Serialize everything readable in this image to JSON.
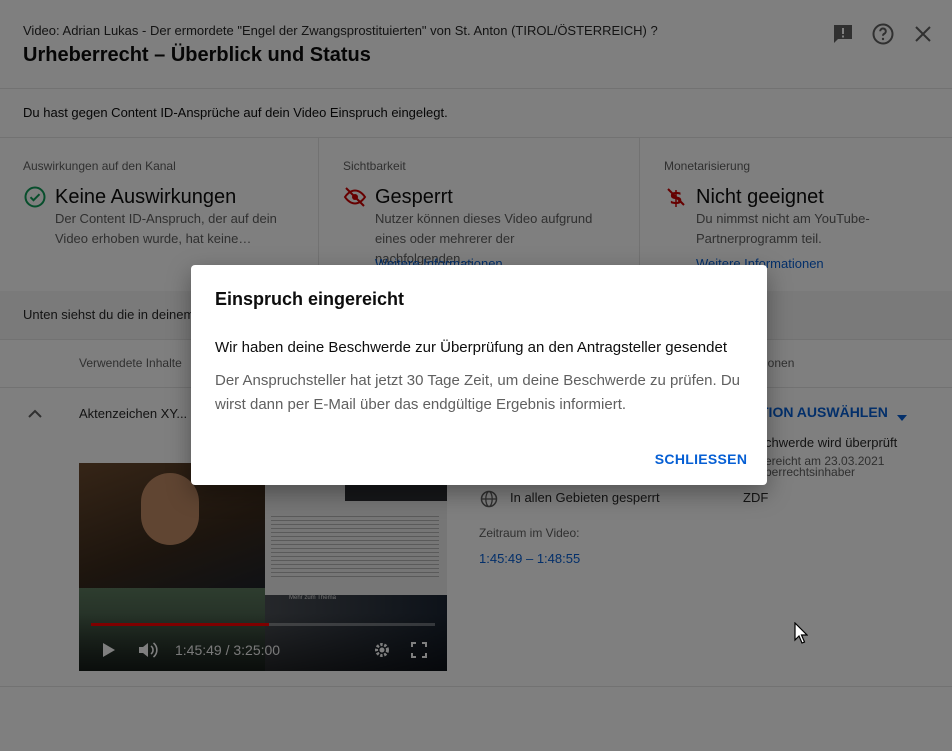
{
  "header": {
    "video_title": "Video: Adrian Lukas - Der ermordete \"Engel der Zwangsprostituierten\" von St. Anton (TIROL/ÖSTERREICH) ?",
    "page_title": "Urheberrecht – Überblick und Status",
    "icons": [
      "feedback-icon",
      "help-icon",
      "close-icon"
    ]
  },
  "notice": "Du hast gegen Content ID-Ansprüche auf dein Video Einspruch eingelegt.",
  "summary": [
    {
      "heading": "Auswirkungen auf den Kanal",
      "status": "Keine Auswirkungen",
      "description": "Der Content ID-Anspruch, der auf dein Video erhoben wurde, hat keine…",
      "link": "",
      "icon": "check-circle-icon",
      "color": "#0f9d58"
    },
    {
      "heading": "Sichtbarkeit",
      "status": "Gesperrt",
      "description": "Nutzer können dieses Video aufgrund eines oder mehrerer der nachfolgenden…",
      "link": "Weitere Informationen",
      "icon": "eye-off-icon",
      "color": "#cc0000"
    },
    {
      "heading": "Monetarisierung",
      "status": "Nicht geeignet",
      "description": "Du nimmst nicht am YouTube-Partnerprogramm teil.",
      "link": "Weitere Informationen",
      "icon": "no-money-icon",
      "color": "#cc0000"
    }
  ],
  "claims_intro": "Unten siehst du die in deinem",
  "table": {
    "col_content": "Verwendete Inhalte",
    "col_actions": "ionen",
    "row_title": "Aktenzeichen XY... u",
    "action_button": "TION AUSWÄHLEN",
    "claim_status": "chwerde wird überprüft",
    "claim_date": "ereicht am 23.03.2021",
    "claim_by": "berrechtsinhaber",
    "restriction": "In allen Gebieten gesperrt",
    "owner": "ZDF",
    "period_label": "Zeitraum im Video:",
    "period_value": "1:45:49 – 1:48:55"
  },
  "player": {
    "time": "1:45:49 / 3:25:00",
    "progress": 0.516,
    "sidebar_title": "Mehr zum Thema"
  },
  "dialog": {
    "title": "Einspruch eingereicht",
    "headline": "Wir haben deine Beschwerde zur Überprüfung an den Antragsteller gesendet",
    "body": "Der Anspruchsteller hat jetzt 30 Tage Zeit, um deine Beschwerde zu prüfen. Du wirst dann per E-Mail über das endgültige Ergebnis informiert.",
    "close_button": "SCHLIESSEN"
  }
}
